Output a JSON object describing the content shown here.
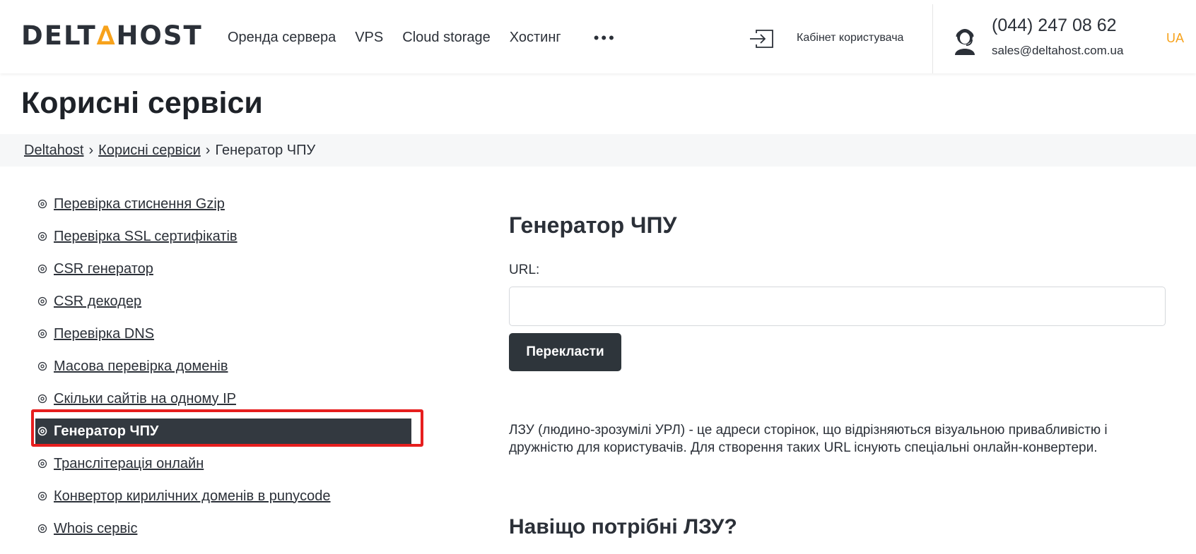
{
  "header": {
    "logo_left": "DELT",
    "logo_mark": "∆",
    "logo_right": "HOST",
    "nav": [
      "Оренда сервера",
      "VPS",
      "Cloud storage",
      "Хостинг"
    ],
    "more": "•••",
    "login_label": "Кабінет користувача",
    "phone": "(044) 247 08 62",
    "email": "sales@deltahost.com.ua",
    "lang": "UA",
    "accent_color": "#f7a21b"
  },
  "page": {
    "title": "Корисні сервіси"
  },
  "breadcrumb": {
    "items": [
      "Deltahost",
      "Корисні сервіси"
    ],
    "current": "Генератор ЧПУ",
    "separator": "›"
  },
  "sidebar": {
    "items": [
      {
        "label": "Перевірка стиснення Gzip",
        "active": false
      },
      {
        "label": "Перевірка SSL сертифікатів",
        "active": false
      },
      {
        "label": "CSR генератор",
        "active": false
      },
      {
        "label": "CSR декодер",
        "active": false
      },
      {
        "label": "Перевірка DNS",
        "active": false
      },
      {
        "label": "Масова перевірка доменів",
        "active": false
      },
      {
        "label": "Скільки сайтів на одному IP",
        "active": false
      },
      {
        "label": "Генератор ЧПУ",
        "active": true
      },
      {
        "label": "Транслітерація онлайн",
        "active": false
      },
      {
        "label": "Конвертор кирилічних доменів в punycode",
        "active": false
      },
      {
        "label": "Whois сервіс",
        "active": false
      }
    ],
    "highlight_color": "#e61e1e"
  },
  "tool": {
    "title": "Генератор ЧПУ",
    "url_label": "URL:",
    "url_value": "",
    "button_label": "Перекласти",
    "description": "ЛЗУ (людино-зрозумілі УРЛ) - це адреси сторінок, що відрізняються візуальною привабливістю і дружністю для користувачів. Для створення таких URL існують спеціальні онлайн-конвертери.",
    "section_title": "Навіщо потрібні ЛЗУ?"
  }
}
